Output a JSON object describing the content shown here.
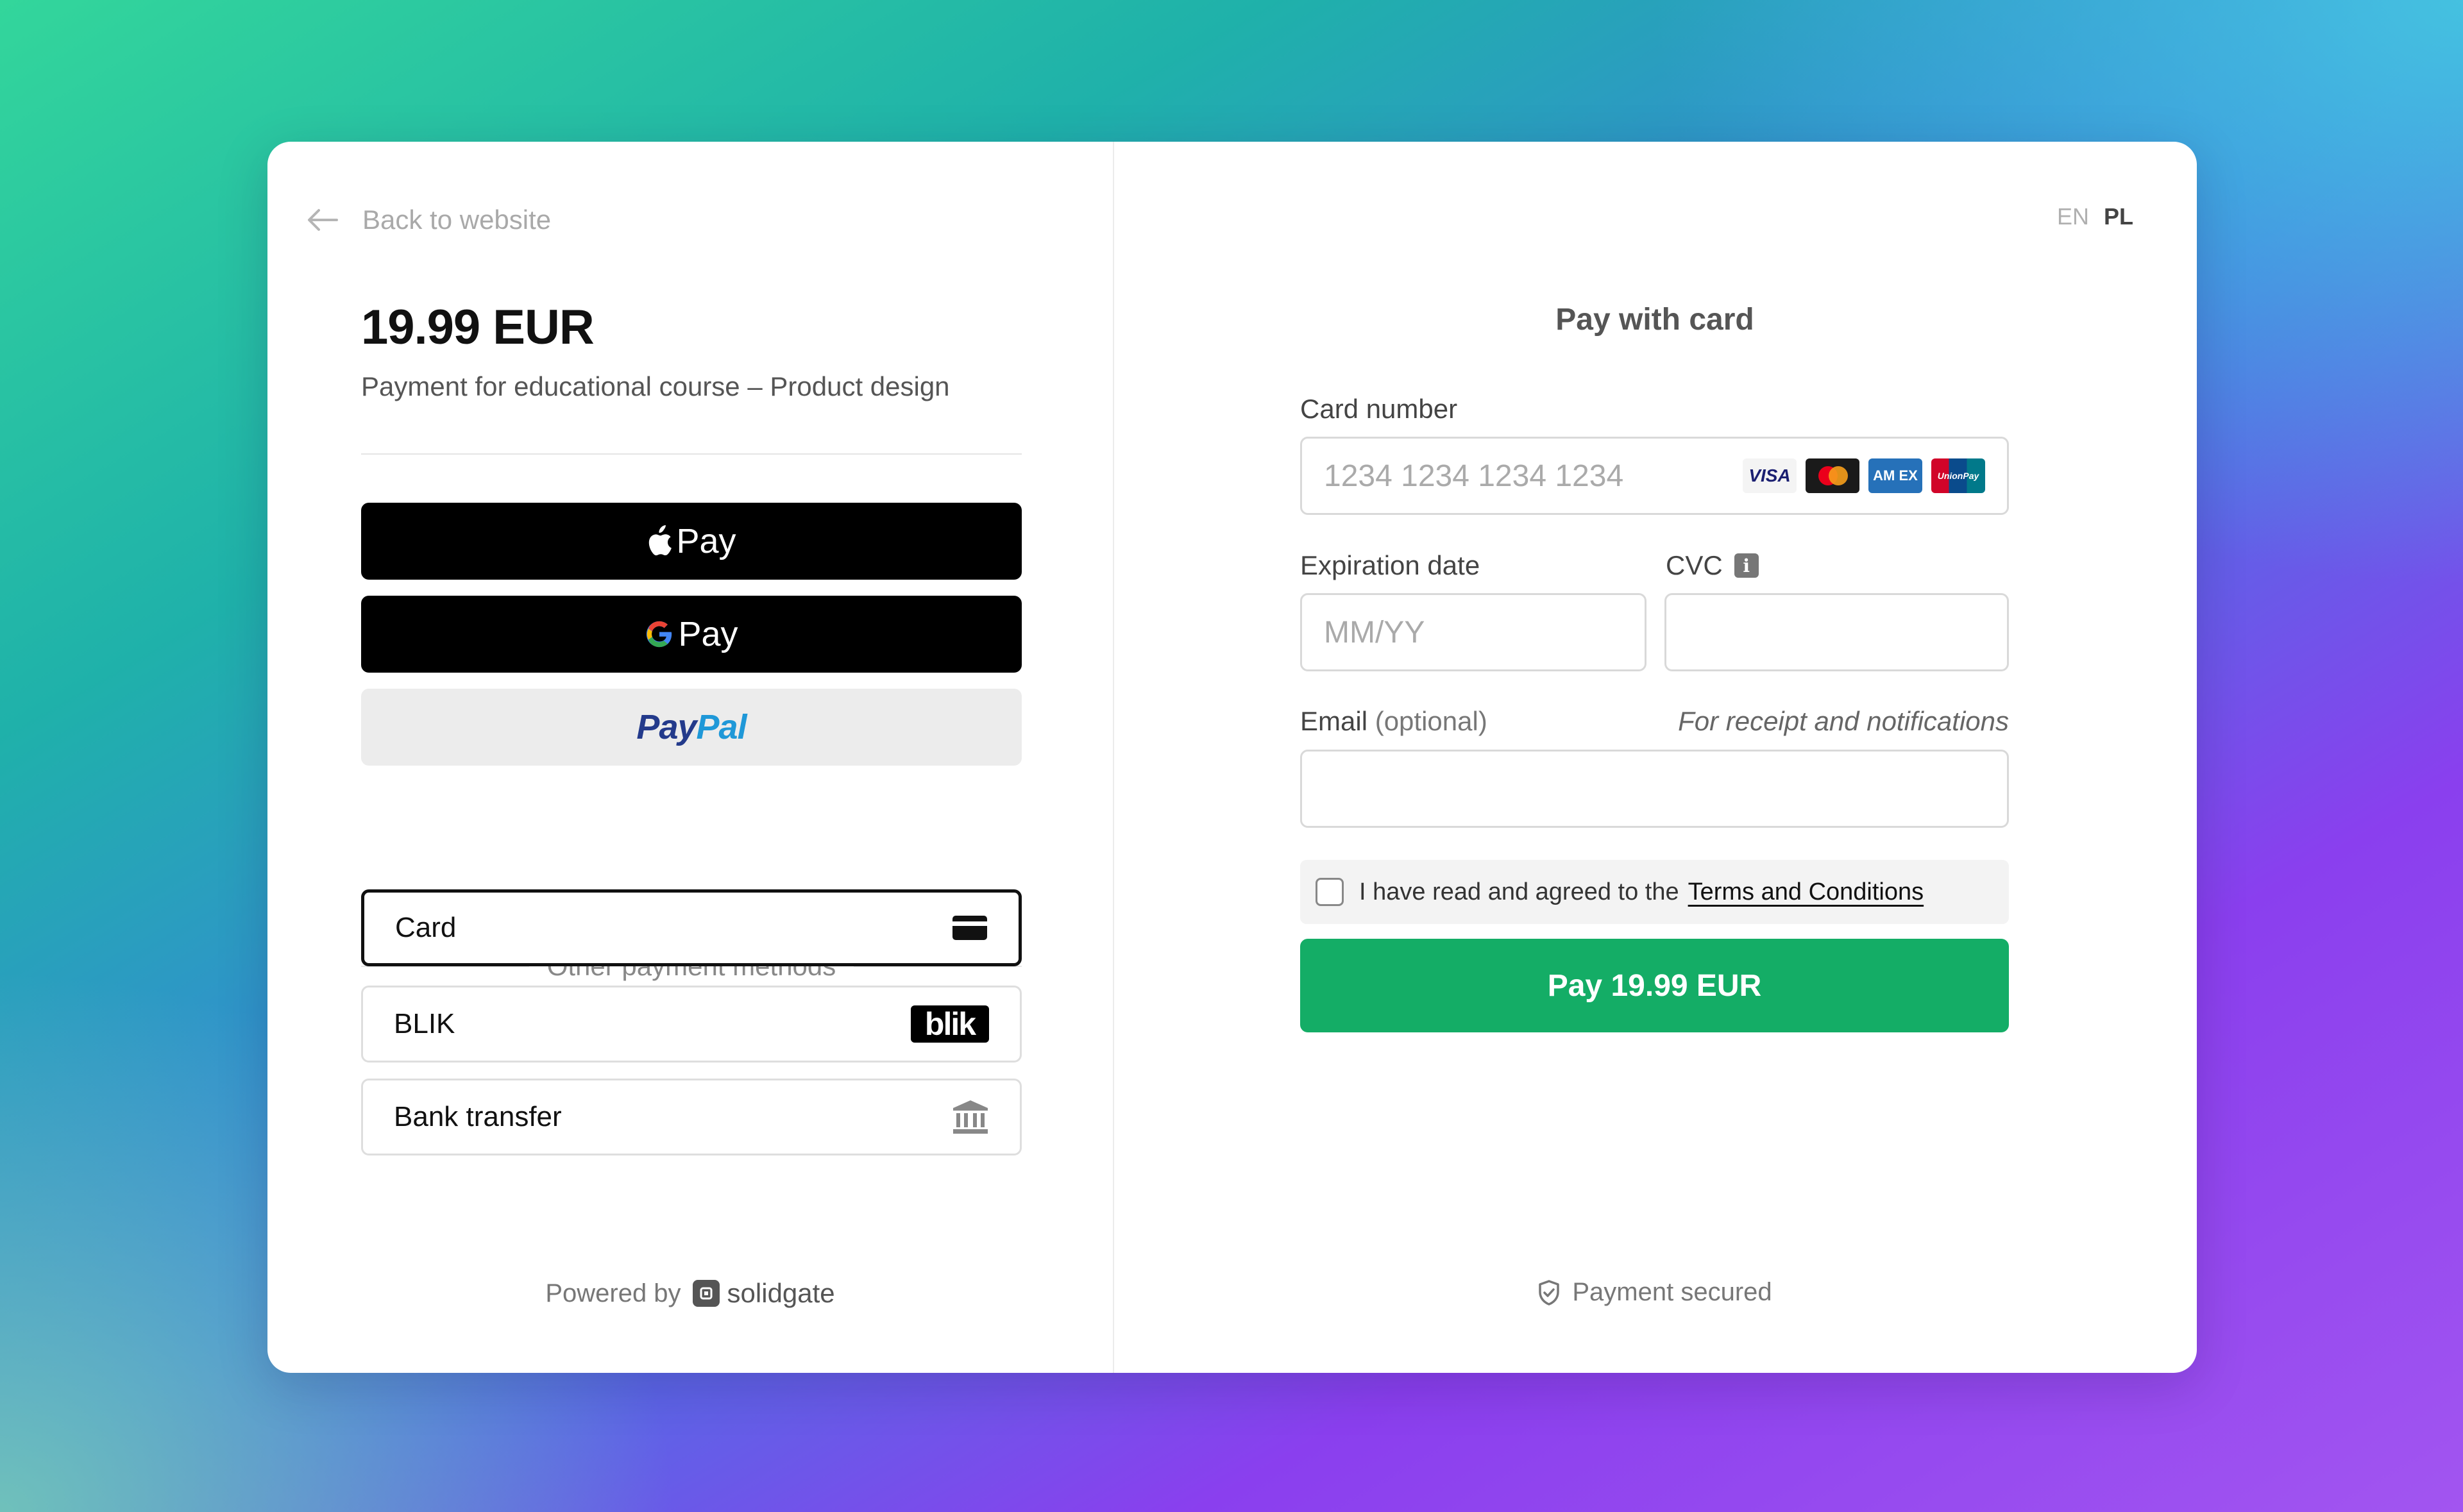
{
  "left": {
    "back_label": "Back to website",
    "amount": "19.99 EUR",
    "description": "Payment for educational course – Product design",
    "wallets": {
      "apple_pay_label": "Pay",
      "google_pay_label": "Pay",
      "paypal_part1": "Pay",
      "paypal_part2": "Pal"
    },
    "other_methods_label": "Other payment methods",
    "methods": [
      {
        "label": "Card",
        "icon": "credit-card-icon",
        "selected": true
      },
      {
        "label": "BLIK",
        "icon": "blik-logo",
        "selected": false
      },
      {
        "label": "Bank transfer",
        "icon": "bank-icon",
        "selected": false
      }
    ],
    "blik_logo_text": "blik",
    "powered_by": "Powered by",
    "provider": "solidgate"
  },
  "right": {
    "languages": [
      "EN",
      "PL"
    ],
    "active_language": "PL",
    "title": "Pay with card",
    "card_number": {
      "label": "Card number",
      "placeholder": "1234 1234 1234 1234",
      "value": ""
    },
    "card_brands": [
      "VISA",
      "Mastercard",
      "AMEX",
      "UnionPay"
    ],
    "brand_texts": {
      "visa": "VISA",
      "amex": "AM EX",
      "unionpay": "UnionPay"
    },
    "expiration": {
      "label": "Expiration date",
      "placeholder": "MM/YY",
      "value": ""
    },
    "cvc": {
      "label": "CVC",
      "info_icon": "i",
      "value": ""
    },
    "email": {
      "label": "Email",
      "optional": "(optional)",
      "hint": "For receipt and notifications",
      "value": ""
    },
    "terms": {
      "text": "I have read and agreed to the",
      "link": "Terms and Conditions",
      "checked": false
    },
    "pay_button": "Pay 19.99 EUR",
    "secured": "Payment secured"
  },
  "colors": {
    "pay_button": "#14ad66",
    "wallet_button": "#000000",
    "paypal_dark": "#233a8b",
    "paypal_light": "#1f98d8"
  }
}
